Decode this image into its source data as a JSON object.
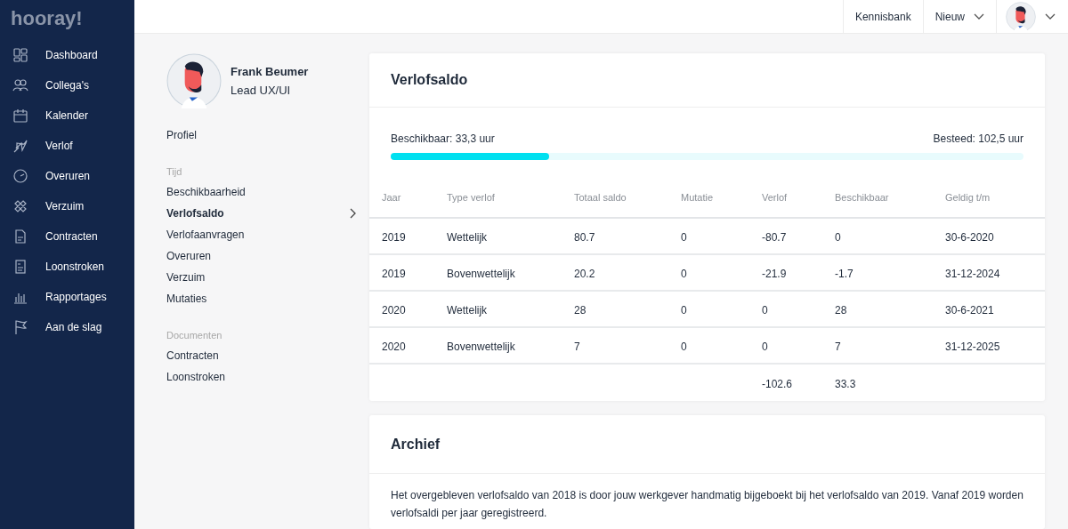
{
  "logo": "hooray!",
  "sidebar": {
    "items": [
      {
        "label": "Dashboard",
        "kind": "dashboard"
      },
      {
        "label": "Collega's",
        "kind": "people"
      },
      {
        "label": "Kalender",
        "kind": "calendar"
      },
      {
        "label": "Verlof",
        "kind": "plane"
      },
      {
        "label": "Overuren",
        "kind": "clock"
      },
      {
        "label": "Verzuim",
        "kind": "bandage"
      },
      {
        "label": "Contracten",
        "kind": "document"
      },
      {
        "label": "Loonstroken",
        "kind": "payslip"
      },
      {
        "label": "Rapportages",
        "kind": "chart"
      },
      {
        "label": "Aan de slag",
        "kind": "flag"
      }
    ]
  },
  "topbar": {
    "links": [
      "Kennisbank",
      "Nieuw"
    ]
  },
  "profile": {
    "name": "Frank Beumer",
    "role": "Lead UX/UI"
  },
  "profile_menu": [
    {
      "items": [
        {
          "label": "Profiel",
          "selected": false
        }
      ]
    },
    {
      "label": "Tijd",
      "items": [
        {
          "label": "Beschikbaarheid",
          "selected": false
        },
        {
          "label": "Verlofsaldo",
          "selected": true
        },
        {
          "label": "Verlofaanvragen",
          "selected": false
        },
        {
          "label": "Overuren",
          "selected": false
        },
        {
          "label": "Verzuim",
          "selected": false
        },
        {
          "label": "Mutaties",
          "selected": false
        }
      ]
    },
    {
      "label": "Documenten",
      "items": [
        {
          "label": "Contracten",
          "selected": false
        },
        {
          "label": "Loonstroken",
          "selected": false
        }
      ]
    }
  ],
  "balance": {
    "title": "Verlofsaldo",
    "available": "Beschikbaar: 33,3 uur",
    "spent": "Besteed: 102,5 uur",
    "level": 0.25
  },
  "table": {
    "columns": [
      "Jaar",
      "Type verlof",
      "Totaal saldo",
      "Mutatie",
      "Verlof",
      "Beschikbaar",
      "Geldig t/m"
    ],
    "rows": [
      [
        "2019",
        "Wettelijk",
        "80.7",
        "0",
        "-80.7",
        "0",
        "30-6-2020"
      ],
      [
        "2019",
        "Bovenwettelijk",
        "20.2",
        "0",
        "-21.9",
        "-1.7",
        "31-12-2024"
      ],
      [
        "2020",
        "Wettelijk",
        "28",
        "0",
        "0",
        "28",
        "30-6-2021"
      ],
      [
        "2020",
        "Bovenwettelijk",
        "7",
        "0",
        "0",
        "7",
        "31-12-2025"
      ]
    ],
    "totals": [
      "-102.6",
      "33.3"
    ]
  },
  "archive": {
    "title": "Archief",
    "text": "Het overgebleven verlofsaldo van 2018 is door jouw werkgever handmatig bijgeboekt bij het verlofsaldo van 2019. Vanaf 2019 worden verlofsaldi per jaar geregistreerd."
  }
}
